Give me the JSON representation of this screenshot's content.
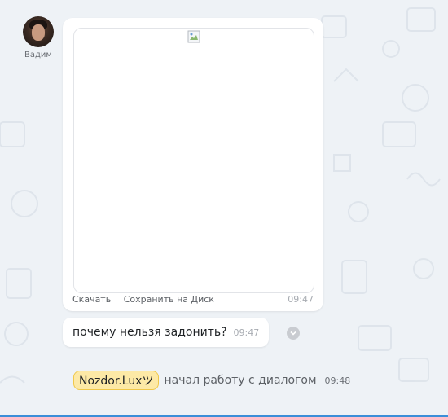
{
  "sender": {
    "name": "Вадим"
  },
  "image_message": {
    "actions": [
      "Скачать",
      "Сохранить на Диск"
    ],
    "time": "09:47"
  },
  "text_message": {
    "text": "почему нельзя задонить?",
    "time": "09:47"
  },
  "system_message": {
    "operator": "Nozdor.Luxツ",
    "text": "начал работу с диалогом",
    "time": "09:48"
  },
  "colors": {
    "background": "#eef2f6",
    "bubble": "#ffffff",
    "operator_badge": "#fde9a6",
    "accent": "#3b8ed8"
  }
}
